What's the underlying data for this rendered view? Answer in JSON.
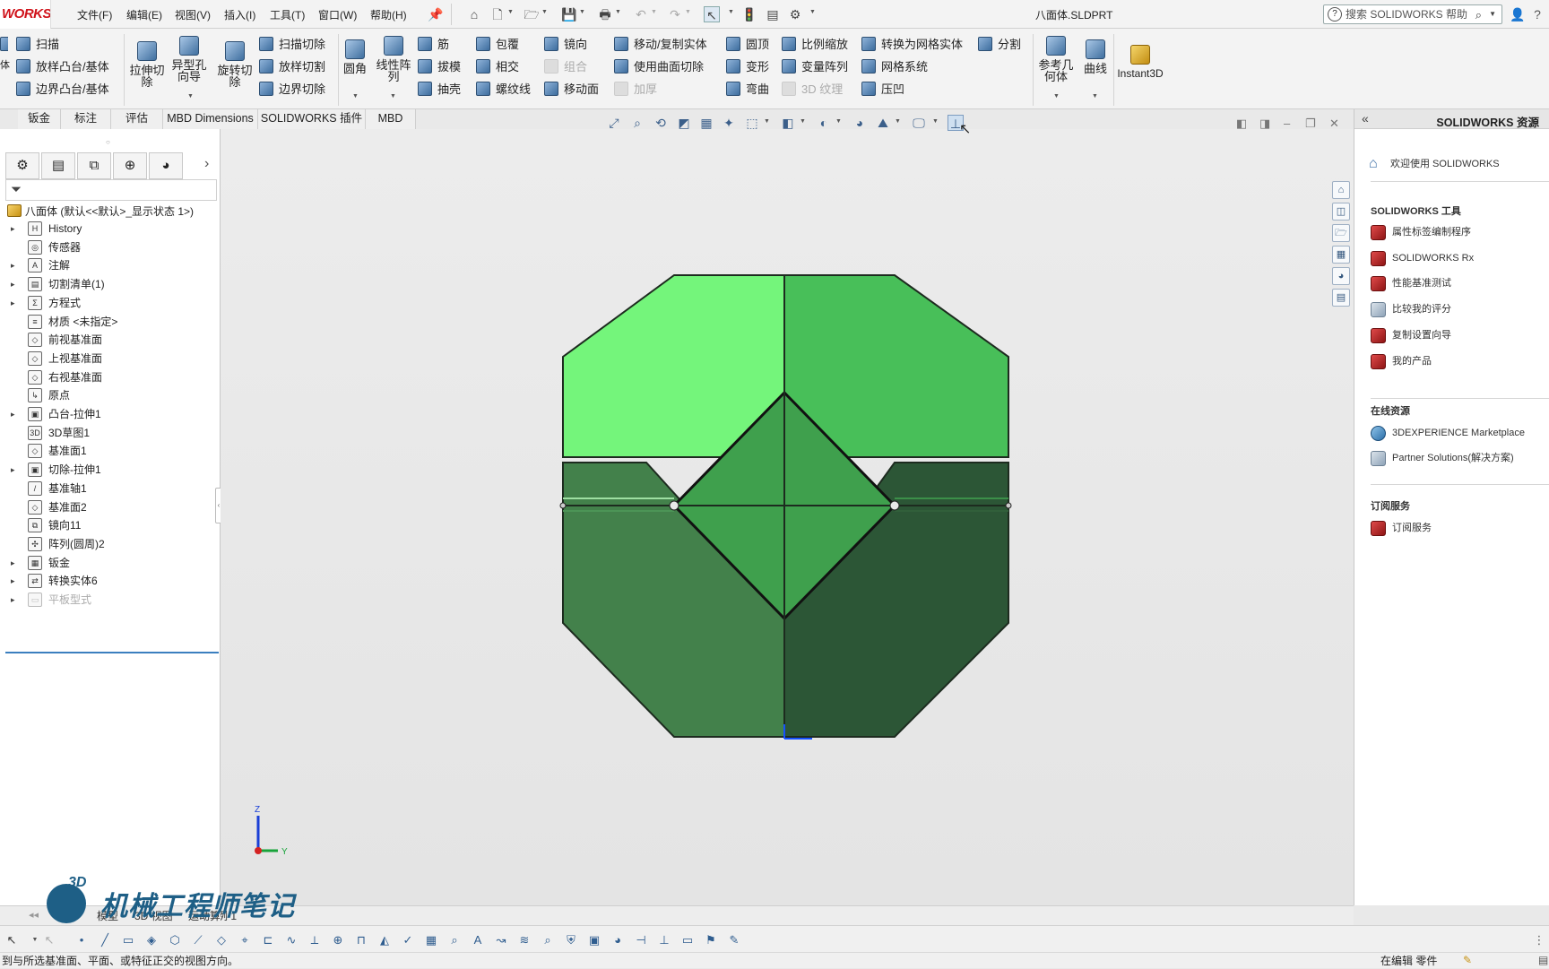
{
  "app": {
    "logo_text": "WORKS",
    "doc_title": "八面体.SLDPRT"
  },
  "menu": [
    "文件(F)",
    "编辑(E)",
    "视图(V)",
    "插入(I)",
    "工具(T)",
    "窗口(W)",
    "帮助(H)"
  ],
  "help_search_placeholder": "搜索 SOLIDWORKS 帮助",
  "commands": {
    "left_col_partial": [
      "扫描",
      "放样凸台/基体",
      "边界凸台/基体"
    ],
    "big": [
      "拉伸切除",
      "异型孔向导",
      "旋转切除"
    ],
    "cut_col": [
      "扫描切除",
      "放样切割",
      "边界切除"
    ],
    "fillet": "圆角",
    "linear_pattern": "线性阵列",
    "col_rib": [
      "筋",
      "拔模",
      "抽壳"
    ],
    "col_wrap": [
      "包覆",
      "相交",
      "螺纹线"
    ],
    "col_mirror": [
      "镜向",
      "组合",
      "移动面"
    ],
    "col_move": [
      "移动/复制实体",
      "使用曲面切除",
      "加厚"
    ],
    "col_dome": [
      "圆顶",
      "变形",
      "弯曲"
    ],
    "col_scale": [
      "比例缩放",
      "变量阵列",
      "3D 纹理"
    ],
    "col_mesh": [
      "转换为网格实体",
      "网格系统",
      "压凹"
    ],
    "split": "分割",
    "ref_geom": "参考几何体",
    "curves": "曲线",
    "instant3d": "Instant3D"
  },
  "tabs": [
    "钣金",
    "标注",
    "评估",
    "MBD Dimensions",
    "SOLIDWORKS 插件",
    "MBD"
  ],
  "feature_tree": {
    "root": "八面体 (默认<<默认>_显示状态 1>)",
    "items": [
      {
        "label": "History",
        "icon": "history-icon",
        "glyph": "H",
        "expandable": true
      },
      {
        "label": "传感器",
        "icon": "sensor-icon",
        "glyph": "◎",
        "expandable": false
      },
      {
        "label": "注解",
        "icon": "annotation-icon",
        "glyph": "A",
        "expandable": true
      },
      {
        "label": "切割清单(1)",
        "icon": "cutlist-icon",
        "glyph": "▤",
        "expandable": true
      },
      {
        "label": "方程式",
        "icon": "equation-icon",
        "glyph": "Σ",
        "expandable": true
      },
      {
        "label": "材质 <未指定>",
        "icon": "material-icon",
        "glyph": "≡",
        "expandable": false
      },
      {
        "label": "前视基准面",
        "icon": "plane-icon",
        "glyph": "◇",
        "expandable": false
      },
      {
        "label": "上视基准面",
        "icon": "plane-icon",
        "glyph": "◇",
        "expandable": false
      },
      {
        "label": "右视基准面",
        "icon": "plane-icon",
        "glyph": "◇",
        "expandable": false
      },
      {
        "label": "原点",
        "icon": "origin-icon",
        "glyph": "↳",
        "expandable": false
      },
      {
        "label": "凸台-拉伸1",
        "icon": "boss-extrude-icon",
        "glyph": "▣",
        "expandable": true
      },
      {
        "label": "3D草图1",
        "icon": "sketch3d-icon",
        "glyph": "3D",
        "expandable": false
      },
      {
        "label": "基准面1",
        "icon": "plane-icon",
        "glyph": "◇",
        "expandable": false
      },
      {
        "label": "切除-拉伸1",
        "icon": "cut-extrude-icon",
        "glyph": "▣",
        "expandable": true
      },
      {
        "label": "基准轴1",
        "icon": "axis-icon",
        "glyph": "/",
        "expandable": false
      },
      {
        "label": "基准面2",
        "icon": "plane-icon",
        "glyph": "◇",
        "expandable": false
      },
      {
        "label": "镜向11",
        "icon": "mirror-icon",
        "glyph": "⧉",
        "expandable": false
      },
      {
        "label": "阵列(圆周)2",
        "icon": "circular-pattern-icon",
        "glyph": "✣",
        "expandable": false
      },
      {
        "label": "钣金",
        "icon": "sheetmetal-icon",
        "glyph": "▦",
        "expandable": true
      },
      {
        "label": "转换实体6",
        "icon": "convert-icon",
        "glyph": "⇄",
        "expandable": true
      },
      {
        "label": "平板型式",
        "icon": "flat-pattern-icon",
        "glyph": "▭",
        "expandable": true,
        "dim": true
      }
    ]
  },
  "task_pane": {
    "title": "SOLIDWORKS 资源",
    "welcome": "欢迎使用 SOLIDWORKS",
    "tools_header": "SOLIDWORKS 工具",
    "tools": [
      "属性标签编制程序",
      "SOLIDWORKS Rx",
      "性能基准测试",
      "比较我的评分",
      "复制设置向导",
      "我的产品"
    ],
    "online_header": "在线资源",
    "online": [
      "3DEXPERIENCE Marketplace",
      "Partner Solutions(解决方案)"
    ],
    "subscription_header": "订阅服务",
    "subscription": [
      "订阅服务"
    ]
  },
  "triad": {
    "z": "Z",
    "y": "Y"
  },
  "bottom_tabs": [
    "模型",
    "3D 视图",
    "运动算例 1"
  ],
  "watermark": {
    "badge": "3D",
    "text": "机械工程师笔记"
  },
  "status": {
    "left": "到与所选基准面、平面、或特征正交的视图方向。",
    "right": "在编辑 零件"
  },
  "colors": {
    "face_top_left": "#74f57b",
    "face_top_right": "#48bf59",
    "face_center": "#3fa04d",
    "face_bottom_left": "#43814b",
    "face_bottom_right": "#2c5636",
    "tree_end_bar": "#3b7fbf"
  }
}
